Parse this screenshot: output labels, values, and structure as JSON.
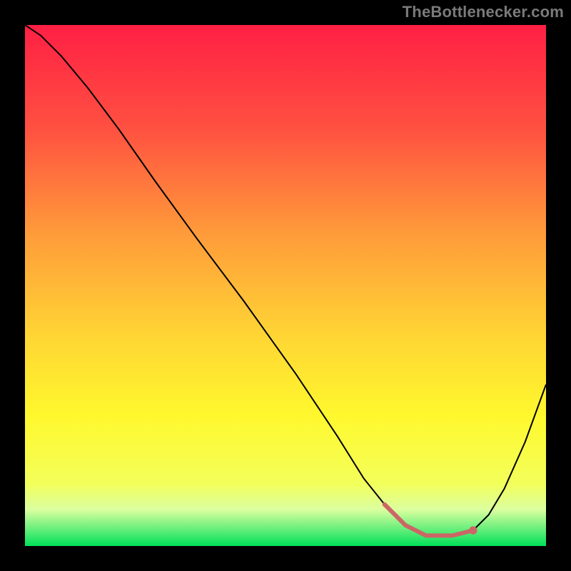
{
  "watermark": "TheBottlenecker.com",
  "chart_data": {
    "type": "line",
    "title": "",
    "xlabel": "",
    "ylabel": "",
    "xlim": [
      0,
      100
    ],
    "ylim": [
      0,
      100
    ],
    "background_gradient": {
      "stops": [
        {
          "offset": 0.0,
          "color": "#ff1f44"
        },
        {
          "offset": 0.2,
          "color": "#ff5141"
        },
        {
          "offset": 0.4,
          "color": "#ff9b3a"
        },
        {
          "offset": 0.6,
          "color": "#ffd634"
        },
        {
          "offset": 0.75,
          "color": "#fff82d"
        },
        {
          "offset": 0.88,
          "color": "#f3ff5a"
        },
        {
          "offset": 0.93,
          "color": "#dcffa0"
        },
        {
          "offset": 1.0,
          "color": "#00e05a"
        }
      ]
    },
    "series": [
      {
        "name": "bottleneck-curve",
        "color": "#000000",
        "stroke_width": 2,
        "x": [
          0,
          3,
          7,
          12,
          18,
          25,
          33,
          42,
          52,
          60,
          65,
          69,
          73,
          77,
          82,
          86,
          89,
          92,
          96,
          100
        ],
        "y": [
          100,
          98,
          94,
          88,
          80,
          70,
          59,
          47,
          33,
          21,
          13,
          8,
          4,
          2,
          2,
          3,
          6,
          11,
          20,
          31
        ]
      }
    ],
    "highlight": {
      "name": "optimal-range",
      "color": "#cc6666",
      "stroke_width": 6,
      "x": [
        69,
        73,
        77,
        82,
        86
      ],
      "y": [
        8,
        4,
        2,
        2,
        3
      ]
    },
    "highlight_dot": {
      "x": 86,
      "y": 3,
      "r": 5.7,
      "color": "#cc6666"
    },
    "grid": false,
    "legend": false
  }
}
